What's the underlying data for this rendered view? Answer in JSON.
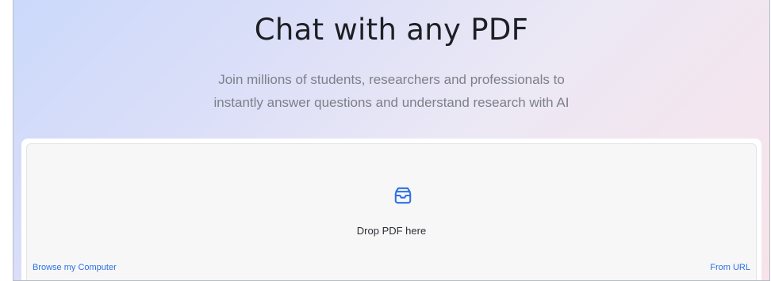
{
  "hero": {
    "title": "Chat with any PDF",
    "subtitle_line1": "Join millions of students, researchers and professionals to",
    "subtitle_line2": "instantly answer questions and understand research with AI"
  },
  "upload": {
    "icon": "inbox-icon",
    "drop_label": "Drop PDF here",
    "browse_label": "Browse my Computer",
    "url_label": "From URL"
  },
  "colors": {
    "accent": "#2f6fe4",
    "title": "#1d1f23",
    "subtitle": "#7d8088"
  }
}
